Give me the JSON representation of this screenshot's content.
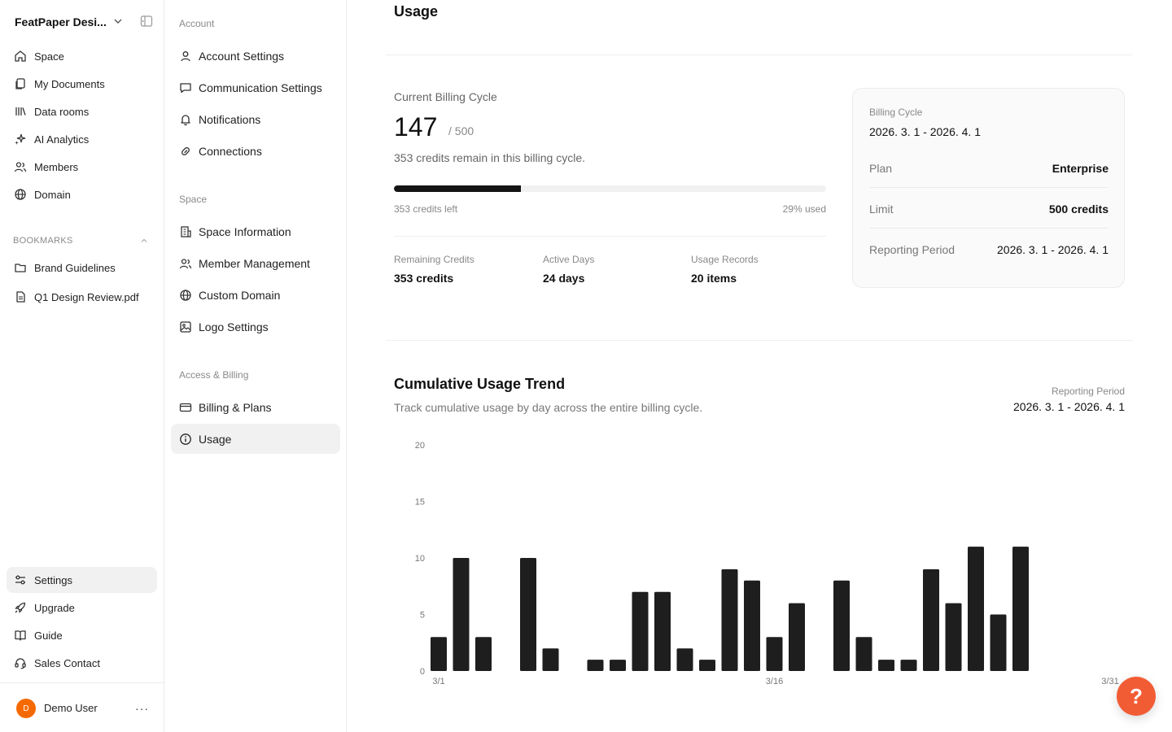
{
  "workspace": {
    "name": "FeatPaper Desi..."
  },
  "sidebar": {
    "items": [
      {
        "label": "Space",
        "icon": "home-icon"
      },
      {
        "label": "My Documents",
        "icon": "documents-icon"
      },
      {
        "label": "Data rooms",
        "icon": "library-icon"
      },
      {
        "label": "AI Analytics",
        "icon": "sparkles-icon"
      },
      {
        "label": "Members",
        "icon": "users-icon"
      },
      {
        "label": "Domain",
        "icon": "globe-icon"
      }
    ],
    "bookmarks_label": "BOOKMARKS",
    "bookmarks": [
      {
        "label": "Brand Guidelines",
        "icon": "folder-icon"
      },
      {
        "label": "Q1 Design Review.pdf",
        "icon": "file-icon"
      }
    ],
    "bottom_items": [
      {
        "label": "Settings",
        "icon": "sliders-icon"
      },
      {
        "label": "Upgrade",
        "icon": "rocket-icon"
      },
      {
        "label": "Guide",
        "icon": "book-icon"
      },
      {
        "label": "Sales Contact",
        "icon": "headset-icon"
      }
    ],
    "user": {
      "initial": "D",
      "name": "Demo User"
    }
  },
  "settings_nav": {
    "sections": [
      {
        "label": "Account",
        "items": [
          {
            "label": "Account Settings",
            "icon": "user-icon"
          },
          {
            "label": "Communication Settings",
            "icon": "message-icon"
          },
          {
            "label": "Notifications",
            "icon": "bell-icon"
          },
          {
            "label": "Connections",
            "icon": "link-icon"
          }
        ]
      },
      {
        "label": "Space",
        "items": [
          {
            "label": "Space Information",
            "icon": "building-icon"
          },
          {
            "label": "Member Management",
            "icon": "users-icon"
          },
          {
            "label": "Custom Domain",
            "icon": "globe-icon"
          },
          {
            "label": "Logo Settings",
            "icon": "image-icon"
          }
        ]
      },
      {
        "label": "Access & Billing",
        "items": [
          {
            "label": "Billing & Plans",
            "icon": "credit-card-icon"
          },
          {
            "label": "Usage",
            "icon": "info-icon"
          }
        ]
      }
    ]
  },
  "usage": {
    "title": "Usage",
    "current_cycle_label": "Current Billing Cycle",
    "used": "147",
    "total": "/ 500",
    "remain_text": "353 credits remain in this billing cycle.",
    "progress": 0.294,
    "credits_left": "353 credits left",
    "percent_used": "29% used",
    "stats": [
      {
        "label": "Remaining Credits",
        "value": "353 credits"
      },
      {
        "label": "Active Days",
        "value": "24 days"
      },
      {
        "label": "Usage Records",
        "value": "20 items"
      }
    ],
    "billing_card": {
      "label": "Billing Cycle",
      "range": "2026. 3. 1 - 2026. 4. 1",
      "rows": [
        {
          "label": "Plan",
          "value": "Enterprise"
        },
        {
          "label": "Limit",
          "value": "500 credits"
        },
        {
          "label": "Reporting Period",
          "value": "2026. 3. 1 - 2026. 4. 1"
        }
      ]
    }
  },
  "trend": {
    "title": "Cumulative Usage Trend",
    "subtitle": "Track cumulative usage by day across the entire billing cycle.",
    "period_label": "Reporting Period",
    "period_value": "2026. 3. 1 - 2026. 4. 1"
  },
  "chart_data": {
    "type": "bar",
    "categories": [
      "3/1",
      "3/2",
      "3/3",
      "3/4",
      "3/5",
      "3/6",
      "3/7",
      "3/8",
      "3/9",
      "3/10",
      "3/11",
      "3/12",
      "3/13",
      "3/14",
      "3/15",
      "3/16",
      "3/17",
      "3/18",
      "3/19",
      "3/20",
      "3/21",
      "3/22",
      "3/23",
      "3/24",
      "3/25",
      "3/26",
      "3/27",
      "3/28",
      "3/29",
      "3/30",
      "3/31"
    ],
    "values": [
      3,
      10,
      3,
      0,
      10,
      2,
      0,
      1,
      1,
      7,
      7,
      2,
      1,
      9,
      8,
      3,
      6,
      0,
      8,
      3,
      1,
      1,
      9,
      6,
      11,
      5,
      11,
      0,
      0,
      0,
      0
    ],
    "x_tick_labels": [
      "3/1",
      "3/16",
      "3/31"
    ],
    "y_ticks": [
      0,
      5,
      10,
      15,
      20
    ],
    "ylim": [
      0,
      20
    ],
    "title": "",
    "xlabel": "",
    "ylabel": "",
    "bar_color": "#1e1e1e",
    "grid": false
  },
  "colors": {
    "accent": "#f25c35",
    "avatar": "#f56a00",
    "bar": "#1e1e1e"
  },
  "help": {
    "label": "?"
  }
}
